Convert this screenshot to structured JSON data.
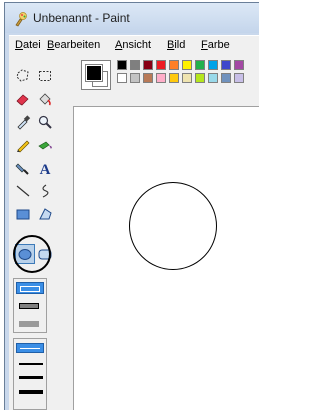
{
  "window": {
    "title": "Unbenannt - Paint"
  },
  "menu": [
    {
      "label": "Datei"
    },
    {
      "label": "Bearbeiten"
    },
    {
      "label": "Ansicht"
    },
    {
      "label": "Bild"
    },
    {
      "label": "Farbe"
    }
  ],
  "tools": [
    {
      "name": "free-select-tool",
      "icon": "free-form-select-icon"
    },
    {
      "name": "rect-select-tool",
      "icon": "rectangle-select-icon"
    },
    {
      "name": "eraser-tool",
      "icon": "eraser-icon"
    },
    {
      "name": "fill-tool",
      "icon": "fill-bucket-icon"
    },
    {
      "name": "color-picker-tool",
      "icon": "eyedropper-icon"
    },
    {
      "name": "magnifier-tool",
      "icon": "magnifier-icon"
    },
    {
      "name": "pencil-tool",
      "icon": "pencil-icon"
    },
    {
      "name": "brush-tool",
      "icon": "brush-icon"
    },
    {
      "name": "airbrush-tool",
      "icon": "airbrush-icon"
    },
    {
      "name": "text-tool",
      "icon": "text-icon",
      "glyph": "A"
    },
    {
      "name": "line-tool",
      "icon": "line-icon"
    },
    {
      "name": "curve-tool",
      "icon": "curve-icon"
    },
    {
      "name": "rectangle-tool",
      "icon": "rectangle-icon"
    },
    {
      "name": "polygon-tool",
      "icon": "polygon-icon"
    },
    {
      "name": "ellipse-tool",
      "icon": "ellipse-icon",
      "selected": true
    },
    {
      "name": "rounded-rect-tool",
      "icon": "rounded-rectangle-icon"
    }
  ],
  "colors": {
    "foreground": "#000000",
    "background": "#ffffff",
    "palette_top": [
      "#000000",
      "#7f7f7f",
      "#880015",
      "#ed1c24",
      "#ff7f27",
      "#fff200",
      "#22b14c",
      "#00a2e8",
      "#3f48cc",
      "#a349a4"
    ],
    "palette_bottom": [
      "#ffffff",
      "#c3c3c3",
      "#b97a57",
      "#ffaec9",
      "#ffc90e",
      "#efe4b0",
      "#b5e61d",
      "#99d9ea",
      "#7092be",
      "#c8bfe7"
    ],
    "selection": "#3a8ee6"
  }
}
